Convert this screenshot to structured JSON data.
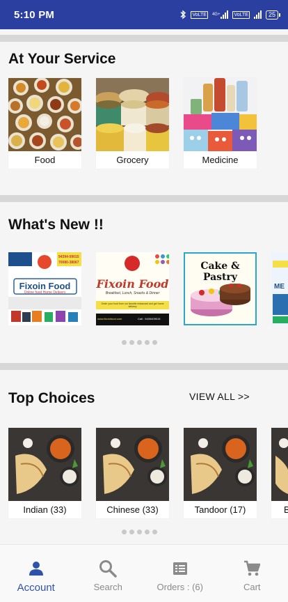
{
  "status_bar": {
    "time": "5:10 PM",
    "network_label": "4G+",
    "volte_label": "VoLTE",
    "battery": "25"
  },
  "service": {
    "title": "At Your Service",
    "items": [
      {
        "label": "Food"
      },
      {
        "label": "Grocery"
      },
      {
        "label": "Medicine"
      }
    ]
  },
  "whats_new": {
    "title": "What's New !!",
    "banners": [
      {
        "title": "Fixoin Food",
        "subtitle": "Online food Home Delivery",
        "phone_a": "94394-09015",
        "phone_b": "70080-38067"
      },
      {
        "title": "Fixoin Food",
        "subtitle": "Breakfast, Lunch, Snacks & Dinner",
        "tagline": "Order your food from our favorite restaurant and get home delivery",
        "url": "www.fixoinfood.com",
        "phone": "Call : 9439409015"
      },
      {
        "title": "Cake & Pastry"
      },
      {
        "title": "ME"
      }
    ]
  },
  "top_choices": {
    "title": "Top Choices",
    "view_all": "VIEW ALL >>",
    "items": [
      {
        "label": "Indian (33)"
      },
      {
        "label": "Chinese (33)"
      },
      {
        "label": "Tandoor (17)"
      },
      {
        "label": "B"
      }
    ]
  },
  "bottom_nav": {
    "items": [
      {
        "label": "Account",
        "icon": "account-icon",
        "active": true
      },
      {
        "label": "Search",
        "icon": "search-icon",
        "active": false
      },
      {
        "label": "Orders : (6)",
        "icon": "orders-icon",
        "active": false
      },
      {
        "label": "Cart",
        "icon": "cart-icon",
        "active": false
      }
    ]
  },
  "colors": {
    "status_bar": "#2a3fa0",
    "active_nav": "#2f53a8",
    "inactive_nav": "#8a8a8a"
  }
}
